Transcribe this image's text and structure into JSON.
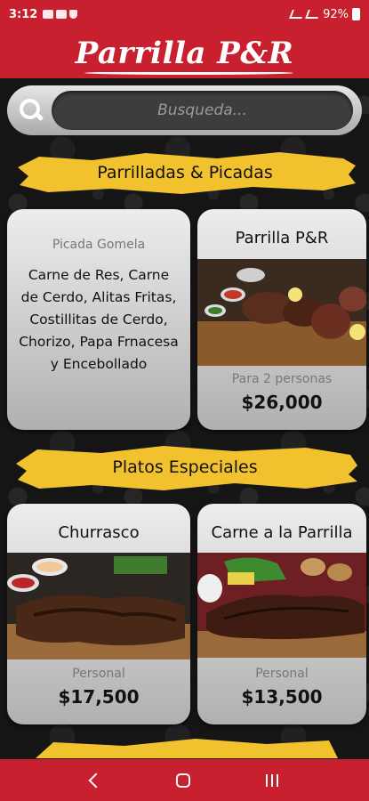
{
  "status_bar": {
    "time": "3:12",
    "battery": "92%",
    "icons": [
      "sim-icon",
      "card-icon",
      "shield-icon",
      "wifi-icon",
      "signal-icon",
      "battery-icon"
    ]
  },
  "header": {
    "logo_text": "Parrilla P&R"
  },
  "search": {
    "placeholder": "Busqueda..."
  },
  "sections": [
    {
      "title": "Parrilladas & Picadas",
      "cards": [
        {
          "subtitle": "Picada Gomela",
          "description": "Carne de Res, Carne de Cerdo, Alitas Fritas, Costillitas de Cerdo, Chorizo, Papa Frnacesa y Encebollado"
        },
        {
          "title": "Parrilla P&R",
          "subtitle": "Para 2 personas",
          "price": "$26,000"
        }
      ]
    },
    {
      "title": "Platos Especiales",
      "cards": [
        {
          "title": "Churrasco",
          "subtitle": "Personal",
          "price": "$17,500"
        },
        {
          "title": "Carne a la Parrilla",
          "subtitle": "Personal",
          "price": "$13,500"
        }
      ]
    }
  ],
  "colors": {
    "brand_red": "#c8202e",
    "banner_yellow": "#f2c12e",
    "card_gray": "#c9c9c9"
  },
  "nav": {
    "icons": [
      "back-icon",
      "home-icon",
      "recents-icon"
    ]
  }
}
